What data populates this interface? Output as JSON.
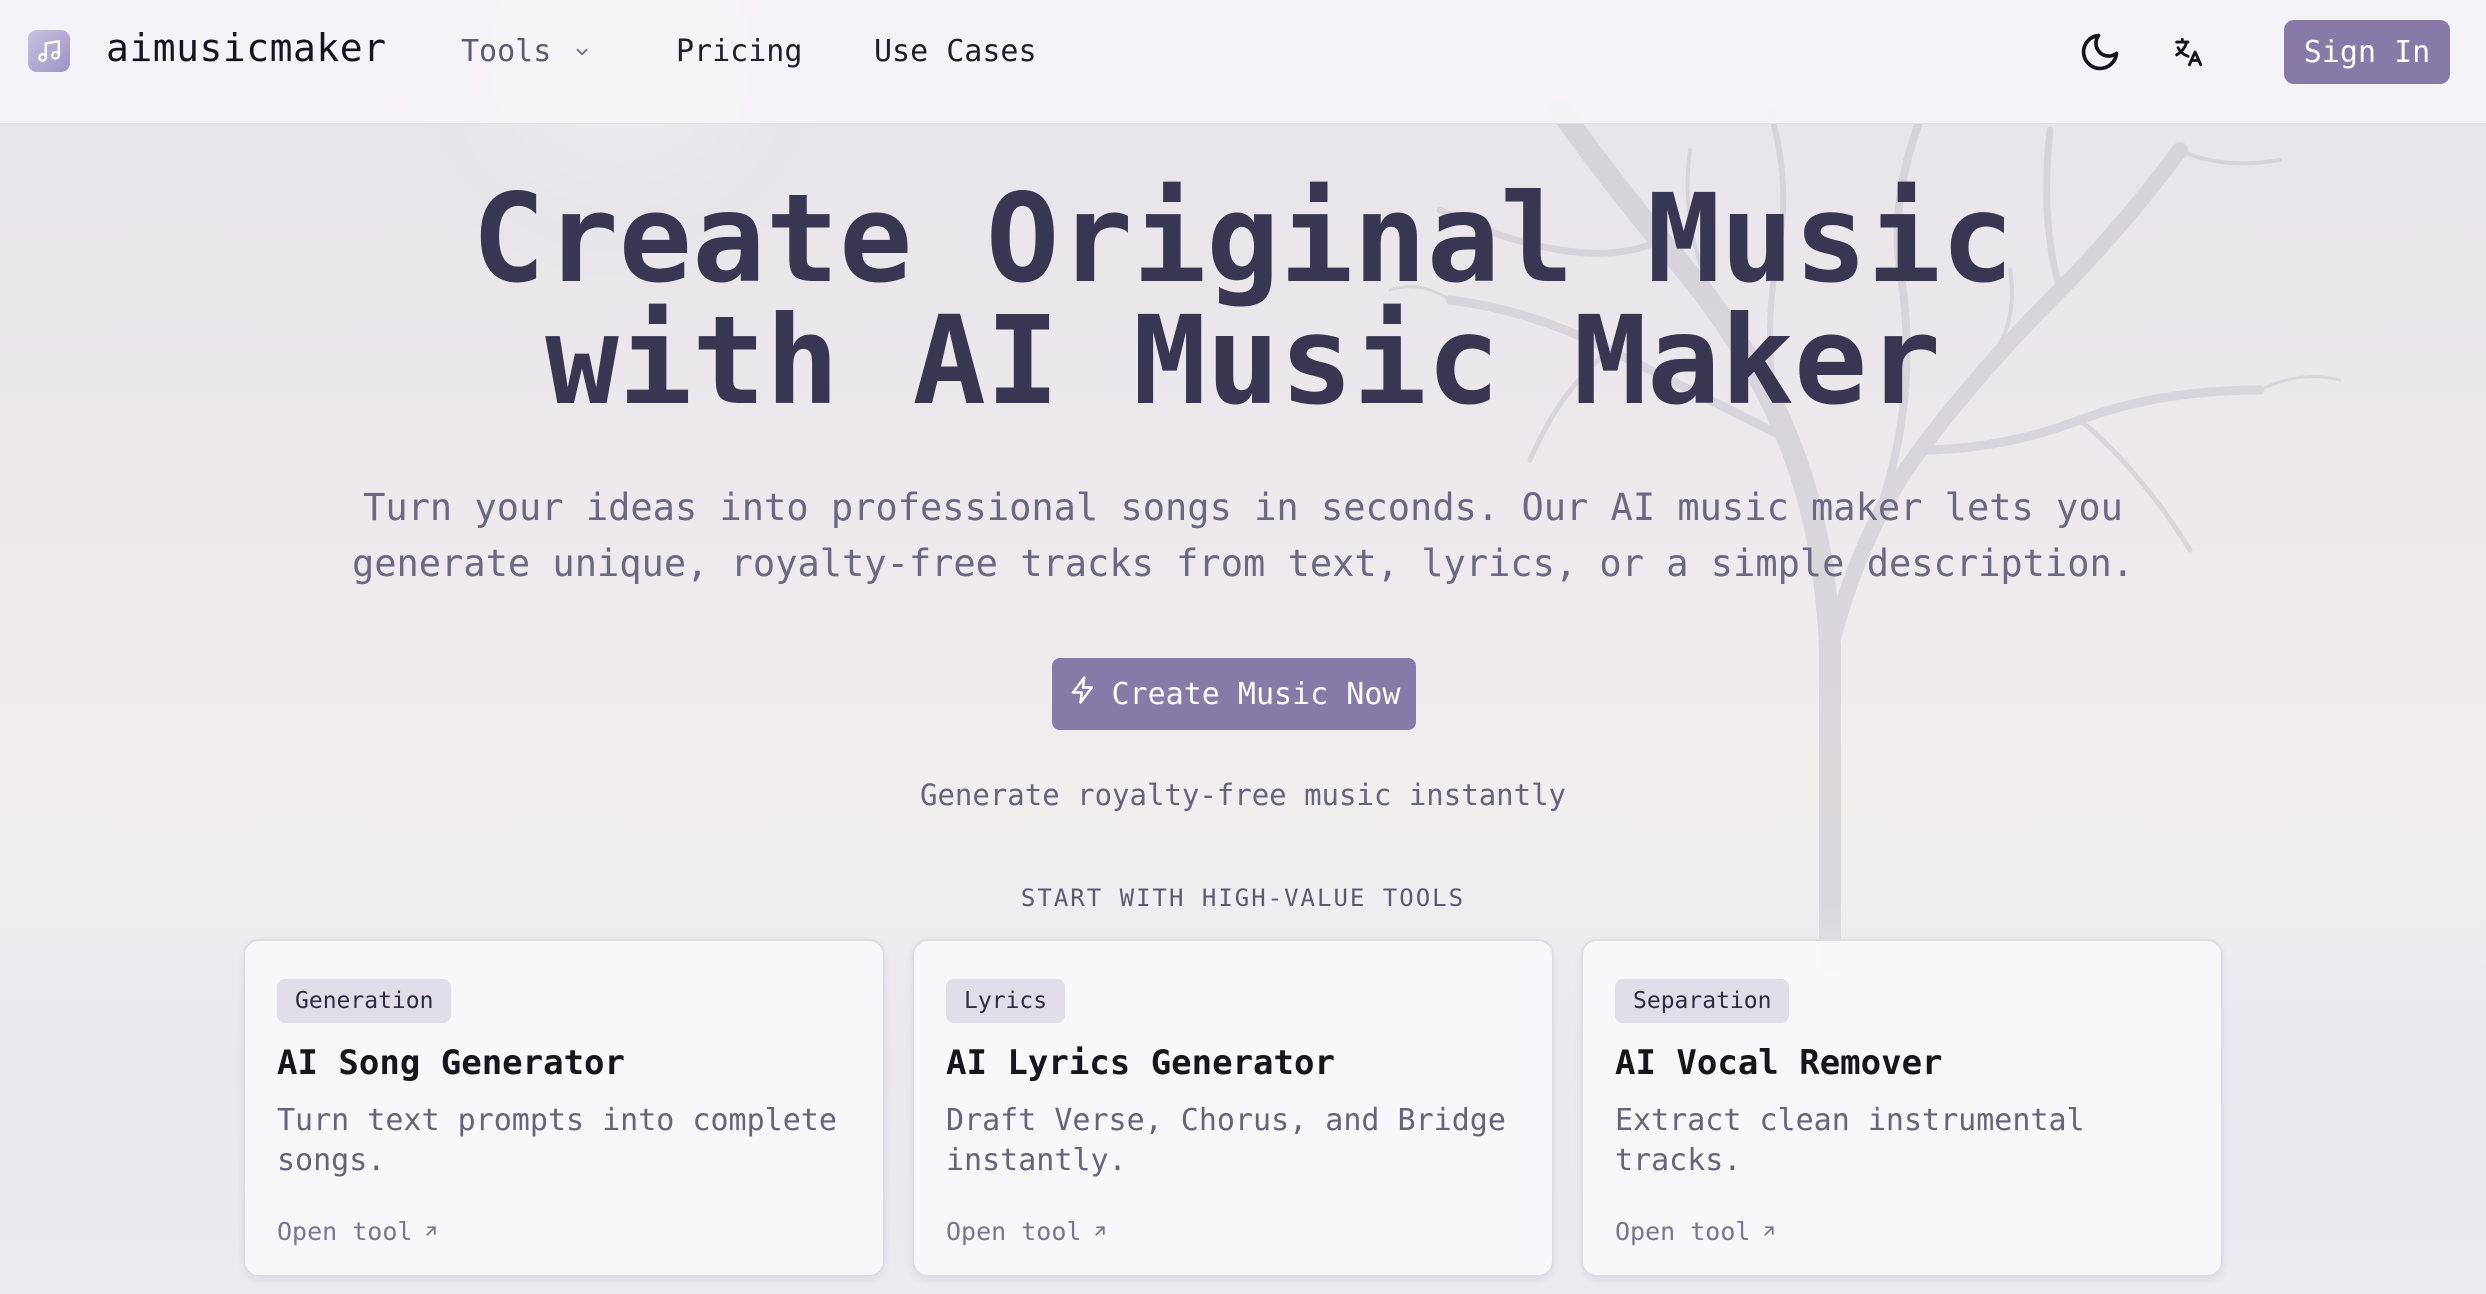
{
  "header": {
    "logo_text": "aimusicmaker",
    "nav": {
      "tools": "Tools",
      "pricing": "Pricing",
      "use_cases": "Use Cases"
    },
    "sign_in": "Sign In"
  },
  "hero": {
    "title_line1": "Create Original Music",
    "title_line2": "with AI Music Maker",
    "subtitle_line1": "Turn your ideas into professional songs in seconds. Our AI music maker lets you",
    "subtitle_line2": "generate unique, royalty-free tracks from text, lyrics, or a simple description.",
    "cta_label": "Create Music Now",
    "cta_note": "Generate royalty-free music instantly"
  },
  "tools_section": {
    "label": "START WITH HIGH-VALUE TOOLS",
    "cards": [
      {
        "badge": "Generation",
        "title": "AI Song Generator",
        "description": "Turn text prompts into complete songs.",
        "link": "Open tool"
      },
      {
        "badge": "Lyrics",
        "title": "AI Lyrics Generator",
        "description": "Draft Verse, Chorus, and Bridge instantly.",
        "link": "Open tool"
      },
      {
        "badge": "Separation",
        "title": "AI Vocal Remover",
        "description": "Extract clean instrumental tracks.",
        "link": "Open tool"
      }
    ]
  },
  "icons": {
    "logo": "music-note-icon",
    "tools_dropdown": "chevron-down-icon",
    "theme": "moon-icon",
    "language": "translate-icon",
    "cta": "lightning-icon",
    "card_link": "arrow-up-right-icon"
  },
  "colors": {
    "accent": "#877aa9",
    "title": "#383650",
    "badge_bg": "#e1dde9"
  }
}
